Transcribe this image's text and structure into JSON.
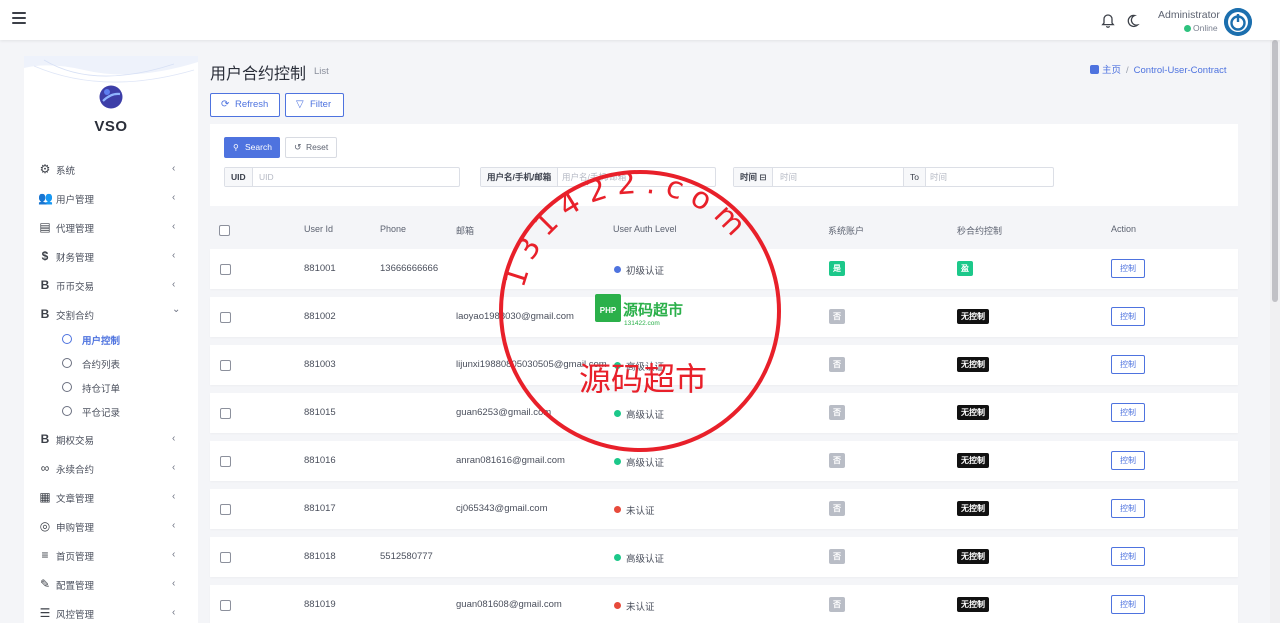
{
  "topbar": {
    "admin_name": "Administrator",
    "admin_status": "Online"
  },
  "sidebar": {
    "logo_text": "VSO",
    "items": [
      {
        "label": "系统",
        "icon": "gear-icon",
        "glyph": "⚙"
      },
      {
        "label": "用户管理",
        "icon": "users-icon",
        "glyph": "👥"
      },
      {
        "label": "代理管理",
        "icon": "id-card-icon",
        "glyph": "▤"
      },
      {
        "label": "财务管理",
        "icon": "dollar-icon",
        "glyph": "$"
      },
      {
        "label": "币币交易",
        "icon": "bitcoin-icon",
        "glyph": "B"
      },
      {
        "label": "交割合约",
        "icon": "bitcoin-icon",
        "glyph": "B"
      },
      {
        "label": "期权交易",
        "icon": "bitcoin-icon",
        "glyph": "B"
      },
      {
        "label": "永续合约",
        "icon": "link-icon",
        "glyph": "∞"
      },
      {
        "label": "文章管理",
        "icon": "newspaper-icon",
        "glyph": "▦"
      },
      {
        "label": "申购管理",
        "icon": "lifebuoy-icon",
        "glyph": "◎"
      },
      {
        "label": "首页管理",
        "icon": "list-icon",
        "glyph": "≡"
      },
      {
        "label": "配置管理",
        "icon": "wrench-icon",
        "glyph": "✎"
      },
      {
        "label": "风控管理",
        "icon": "list-ul-icon",
        "glyph": "☰"
      }
    ],
    "sub_items": [
      {
        "label": "用户控制"
      },
      {
        "label": "合约列表"
      },
      {
        "label": "持仓订单"
      },
      {
        "label": "平仓记录"
      }
    ]
  },
  "header": {
    "title": "用户合约控制",
    "subtitle": "List",
    "breadcrumb_home": "主页",
    "breadcrumb_current": "Control-User-Contract",
    "refresh_label": "Refresh",
    "filter_label": "Filter"
  },
  "search": {
    "search_label": "Search",
    "reset_label": "Reset",
    "uid_label": "UID",
    "uid_placeholder": "UID",
    "user_label": "用户名/手机/邮箱",
    "user_placeholder": "用户名/手机/邮箱",
    "time_label": "时间 ⊟",
    "time_placeholder": "时间",
    "to_label": "To",
    "time_end_placeholder": "时间"
  },
  "table": {
    "headers": [
      "User Id",
      "Phone",
      "邮箱",
      "User Auth Level",
      "系统账户",
      "秒合约控制",
      "Action"
    ],
    "action_label": "控制",
    "rows": [
      {
        "id": "881001",
        "phone": "13666666666",
        "email": "",
        "auth": "初级认证",
        "auth_color": "#4e73df",
        "system": "是",
        "control": "盈"
      },
      {
        "id": "881002",
        "phone": "",
        "email": "laoyao1988030@gmail.com",
        "auth": "",
        "auth_color": "",
        "system": "否",
        "control": "无控制"
      },
      {
        "id": "881003",
        "phone": "",
        "email": "lijunxi19880805030505@gmail.com",
        "auth": "高级认证",
        "auth_color": "#1cc88a",
        "system": "否",
        "control": "无控制"
      },
      {
        "id": "881015",
        "phone": "",
        "email": "guan6253@gmail.com",
        "auth": "高级认证",
        "auth_color": "#1cc88a",
        "system": "否",
        "control": "无控制"
      },
      {
        "id": "881016",
        "phone": "",
        "email": "anran081616@gmail.com",
        "auth": "高级认证",
        "auth_color": "#1cc88a",
        "system": "否",
        "control": "无控制"
      },
      {
        "id": "881017",
        "phone": "",
        "email": "cj065343@gmail.com",
        "auth": "未认证",
        "auth_color": "#e74a3b",
        "system": "否",
        "control": "无控制"
      },
      {
        "id": "881018",
        "phone": "5512580777",
        "email": "",
        "auth": "高级认证",
        "auth_color": "#1cc88a",
        "system": "否",
        "control": "无控制"
      },
      {
        "id": "881019",
        "phone": "",
        "email": "guan081608@gmail.com",
        "auth": "未认证",
        "auth_color": "#e74a3b",
        "system": "否",
        "control": "无控制"
      }
    ]
  },
  "watermark": {
    "ring_text": "131422.com",
    "center_text": "源码超市",
    "badge_text": "源码超市",
    "badge_prefix": "PHP",
    "badge_sub": "131422.com"
  },
  "colors": {
    "accent": "#4e73df",
    "success": "#1cc88a",
    "danger": "#e74a3b",
    "stamp": "#e8202a"
  }
}
